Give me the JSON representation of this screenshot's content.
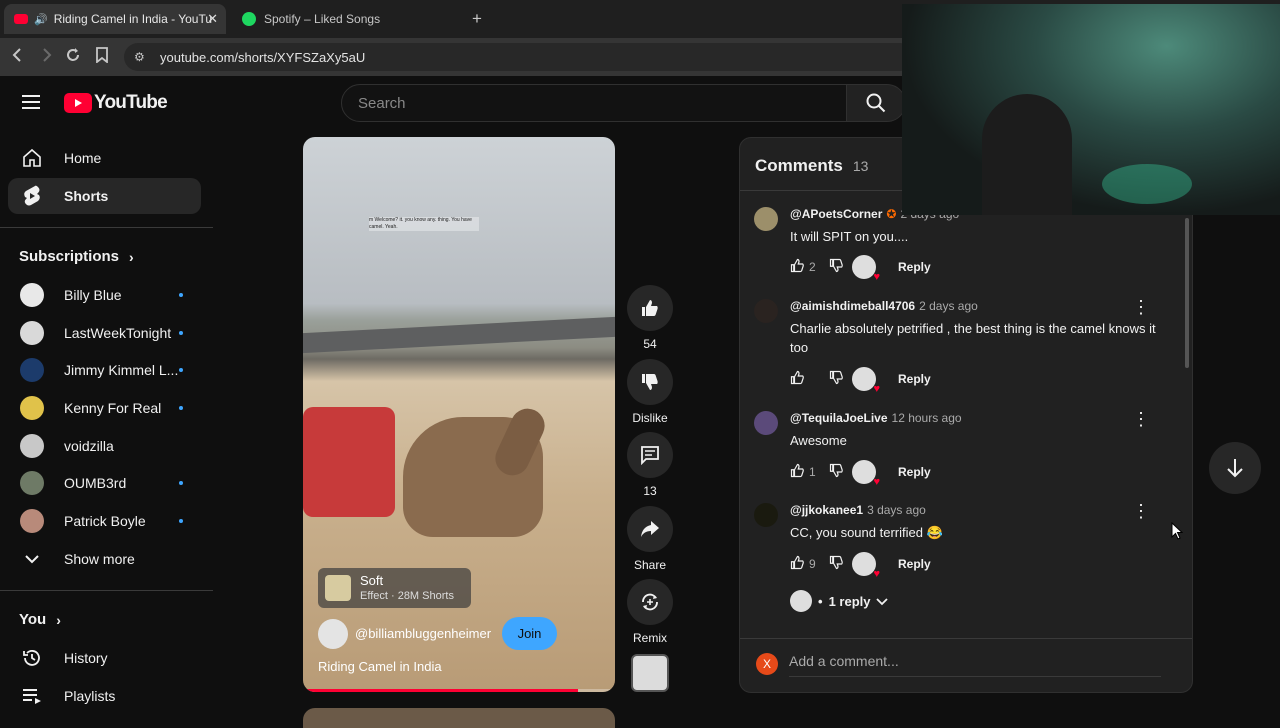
{
  "browser": {
    "tabs": [
      {
        "title": "Riding Camel in India - YouTu"
      },
      {
        "title": "Spotify – Liked Songs"
      }
    ],
    "new_tab": "+",
    "url": "youtube.com/shorts/XYFSZaXy5aU"
  },
  "header": {
    "logo_text": "YouTube",
    "search_placeholder": "Search"
  },
  "sidebar": {
    "home": "Home",
    "shorts": "Shorts",
    "subscriptions_title": "Subscriptions",
    "subscriptions": [
      {
        "name": "Billy Blue",
        "color": "#e8e8e8"
      },
      {
        "name": "LastWeekTonight",
        "color": "#d9d9d9"
      },
      {
        "name": "Jimmy Kimmel L...",
        "color": "#1c3b6b"
      },
      {
        "name": "Kenny For Real",
        "color": "#e0c24a"
      },
      {
        "name": "voidzilla",
        "color": "#c8c8c8"
      },
      {
        "name": "OUMB3rd",
        "color": "#6e7a66"
      },
      {
        "name": "Patrick Boyle",
        "color": "#b88a7a"
      }
    ],
    "show_more": "Show more",
    "you_title": "You",
    "history": "History",
    "playlists": "Playlists"
  },
  "short": {
    "overlay_caption": "m Welcome? it. you know any. thing. You have camel. Yeah.",
    "effect_name": "Soft",
    "effect_meta": "Effect · 28M Shorts",
    "channel": "@billiambluggenheimer",
    "join": "Join",
    "title": "Riding Camel in India",
    "progress": 0.88
  },
  "actions": {
    "like_count": "54",
    "dislike": "Dislike",
    "comment_count": "13",
    "share": "Share",
    "remix": "Remix"
  },
  "comments_panel": {
    "title": "Comments",
    "count": "13",
    "add_placeholder": "Add a comment...",
    "user_initial": "X",
    "items": [
      {
        "author": "@APoetsCorner",
        "time": "2 days ago",
        "text": "It will SPIT on you....",
        "likes": "2",
        "reply": "Reply"
      },
      {
        "author": "@aimishdimeball4706",
        "time": "2 days ago",
        "text": "Charlie absolutely petrified , the best thing is the camel knows it too",
        "likes": "",
        "reply": "Reply"
      },
      {
        "author": "@TequilaJoeLive",
        "time": "12 hours ago",
        "text": "Awesome",
        "likes": "1",
        "reply": "Reply"
      },
      {
        "author": "@jjkokanee1",
        "time": "3 days ago",
        "text": "CC, you sound terrified 😂",
        "likes": "9",
        "reply": "Reply"
      }
    ],
    "replies_toggle": "1 reply"
  },
  "colors": {
    "accent_red": "#ff0033",
    "join_blue": "#3ea6ff"
  }
}
